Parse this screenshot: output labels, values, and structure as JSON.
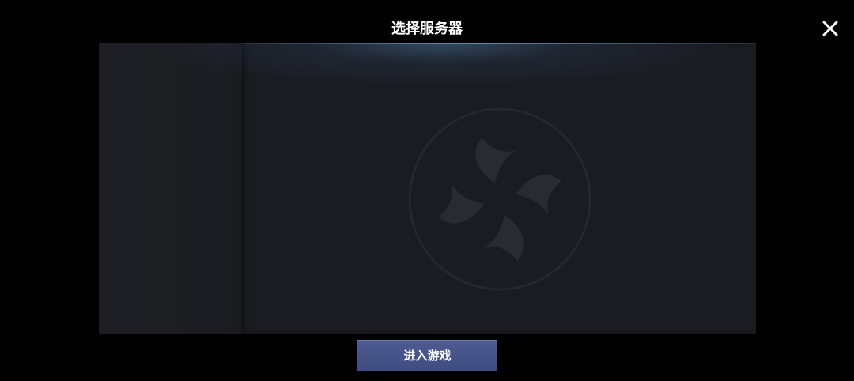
{
  "dialog": {
    "title": "选择服务器",
    "close_icon": "close-icon"
  },
  "server_list": {
    "emblem_icon": "game-logo-emblem-icon"
  },
  "footer": {
    "enter_button_label": "进入游戏"
  },
  "colors": {
    "background": "#000000",
    "panel": "#1b1c21",
    "button": "#4a5a8e",
    "glow": "#4f7fa8"
  }
}
